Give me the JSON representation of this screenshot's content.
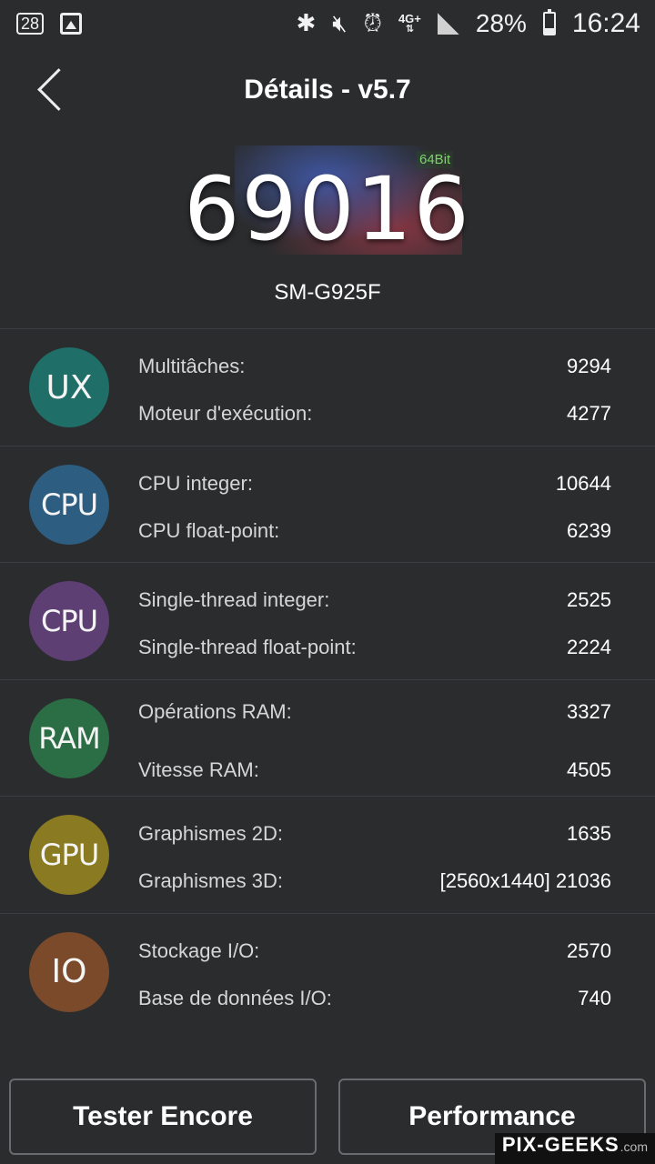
{
  "status_bar": {
    "notification_count": "28",
    "network": "4G+",
    "battery_percent": "28%",
    "battery_level": 0.28,
    "time": "16:24",
    "icons": [
      "notification-badge-icon",
      "gallery-icon",
      "bluetooth-icon",
      "mute-icon",
      "alarm-icon",
      "network-icon",
      "signal-icon",
      "battery-icon"
    ]
  },
  "header": {
    "title": "Détails - v5.7"
  },
  "score": {
    "value": "69016",
    "bit_tag": "64Bit",
    "device": "SM-G925F"
  },
  "categories": [
    {
      "badge": "UX",
      "color": "#1f6e67",
      "metrics": [
        {
          "label": "Multitâches:",
          "value": "9294"
        },
        {
          "label": "Moteur d'exécution:",
          "value": "4277"
        }
      ]
    },
    {
      "badge": "CPU",
      "color": "#2d5d80",
      "metrics": [
        {
          "label": "CPU integer:",
          "value": "10644"
        },
        {
          "label": "CPU float-point:",
          "value": "6239"
        }
      ]
    },
    {
      "badge": "CPU",
      "color": "#5e3f74",
      "metrics": [
        {
          "label": "Single-thread integer:",
          "value": "2525"
        },
        {
          "label": "Single-thread float-point:",
          "value": "2224"
        }
      ]
    },
    {
      "badge": "RAM",
      "color": "#2b6d44",
      "metrics": [
        {
          "label": "Opérations RAM:",
          "value": "3327"
        },
        {
          "label": "Vitesse RAM:",
          "value": "4505"
        }
      ]
    },
    {
      "badge": "GPU",
      "color": "#8a7a22",
      "metrics": [
        {
          "label": "Graphismes 2D:",
          "value": "1635"
        },
        {
          "label": "Graphismes 3D:",
          "value": "[2560x1440] 21036"
        }
      ]
    },
    {
      "badge": "IO",
      "color": "#7a4a2b",
      "metrics": [
        {
          "label": "Stockage I/O:",
          "value": "2570"
        },
        {
          "label": "Base de données I/O:",
          "value": "740"
        }
      ]
    }
  ],
  "buttons": {
    "retest": "Tester Encore",
    "performance": "Performance"
  },
  "watermark": {
    "main": "PIX-GEEKS",
    "tld": ".com"
  }
}
